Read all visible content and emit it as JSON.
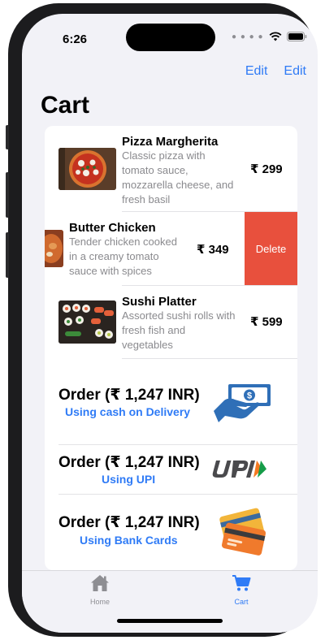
{
  "status": {
    "time": "6:26"
  },
  "nav": {
    "edit_left": "Edit",
    "edit_right": "Edit"
  },
  "page": {
    "title": "Cart"
  },
  "cart_items": [
    {
      "name": "Pizza Margherita",
      "desc": [
        "Classic pizza with",
        "tomato sauce,",
        "mozzarella cheese, and",
        "fresh basil"
      ],
      "price": "₹ 299"
    },
    {
      "name": "Butter Chicken",
      "desc": [
        "Tender chicken cooked",
        "in a creamy tomato",
        "sauce with spices"
      ],
      "price": "₹ 349"
    },
    {
      "name": "Sushi Platter",
      "desc": [
        "Assorted sushi rolls with",
        "fresh fish and",
        "vegetables"
      ],
      "price": "₹ 599"
    }
  ],
  "swipe_action": {
    "label": "Delete",
    "color": "#e8503d"
  },
  "orders": [
    {
      "title": "Order (₹ 1,247 INR)",
      "subtitle": "Using cash on Delivery",
      "icon": "cash-hand-icon"
    },
    {
      "title": "Order (₹ 1,247 INR)",
      "subtitle": "Using UPI",
      "icon": "upi-logo"
    },
    {
      "title": "Order (₹ 1,247 INR)",
      "subtitle": "Using Bank Cards",
      "icon": "bank-cards-icon"
    }
  ],
  "tabs": [
    {
      "label": "Home",
      "icon": "home-icon",
      "selected": false
    },
    {
      "label": "Cart",
      "icon": "cart-icon",
      "selected": true
    }
  ],
  "colors": {
    "accent": "#2f7bf6",
    "delete": "#e8503d",
    "background": "#f2f2f7"
  }
}
